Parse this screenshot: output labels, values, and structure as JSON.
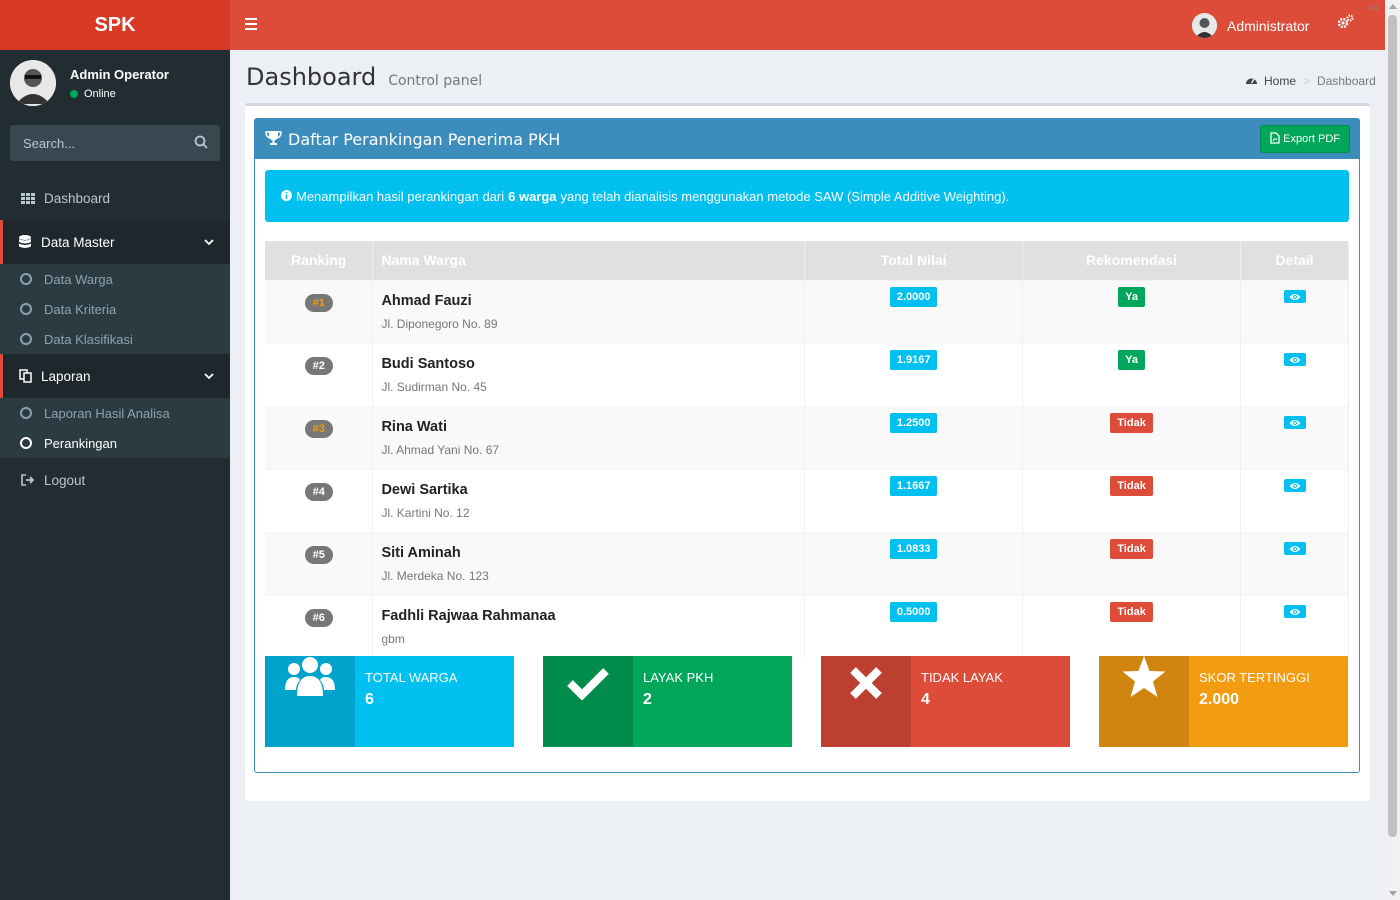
{
  "app": {
    "logo": "SPK"
  },
  "user": {
    "name": "Admin Operator",
    "status": "Online"
  },
  "search": {
    "placeholder": "Search..."
  },
  "sidebar": {
    "items": [
      {
        "label": "Dashboard",
        "icon": "grid-icon"
      },
      {
        "label": "Data Master",
        "icon": "database-icon",
        "children": [
          "Data Warga",
          "Data Kriteria",
          "Data Klasifikasi"
        ]
      },
      {
        "label": "Laporan",
        "icon": "copy-icon",
        "children": [
          "Laporan Hasil Analisa",
          "Perankingan"
        ]
      },
      {
        "label": "Logout",
        "icon": "sign-out-icon"
      }
    ]
  },
  "navbar": {
    "username": "Administrator"
  },
  "header": {
    "title": "Dashboard",
    "subtitle": "Control panel"
  },
  "breadcrumb": {
    "home": "Home",
    "current": "Dashboard"
  },
  "box": {
    "title": "Daftar Perankingan Penerima PKH",
    "export_label": "Export PDF"
  },
  "callout": {
    "prefix": "Menampilkan hasil perankingan dari",
    "bold": "6 warga",
    "suffix": "yang telah dianalisis menggunakan metode SAW (Simple Additive Weighting)."
  },
  "table": {
    "headers": [
      "Ranking",
      "Nama Warga",
      "Total Nilai",
      "Rekomendasi",
      "Detail"
    ],
    "rows": [
      {
        "rank": "#1",
        "name": "Ahmad Fauzi",
        "address": "Jl. Diponegoro No. 89",
        "score": "2.0000",
        "rec": "Ya"
      },
      {
        "rank": "#2",
        "name": "Budi Santoso",
        "address": "Jl. Sudirman No. 45",
        "score": "1.9167",
        "rec": "Ya"
      },
      {
        "rank": "#3",
        "name": "Rina Wati",
        "address": "Jl. Ahmad Yani No. 67",
        "score": "1.2500",
        "rec": "Tidak"
      },
      {
        "rank": "#4",
        "name": "Dewi Sartika",
        "address": "Jl. Kartini No. 12",
        "score": "1.1667",
        "rec": "Tidak"
      },
      {
        "rank": "#5",
        "name": "Siti Aminah",
        "address": "Jl. Merdeka No. 123",
        "score": "1.0833",
        "rec": "Tidak"
      },
      {
        "rank": "#6",
        "name": "Fadhli Rajwaa Rahmanaa",
        "address": "gbm",
        "score": "0.5000",
        "rec": "Tidak"
      }
    ]
  },
  "stats": [
    {
      "label": "TOTAL WARGA",
      "value": "6",
      "icon": "users-icon",
      "color": "#00c0ef",
      "dark": "#00a3cb"
    },
    {
      "label": "LAYAK PKH",
      "value": "2",
      "icon": "check-icon",
      "color": "#00a65a",
      "dark": "#008d4c"
    },
    {
      "label": "TIDAK LAYAK",
      "value": "4",
      "icon": "times-icon",
      "color": "#dd4b39",
      "dark": "#bc4030"
    },
    {
      "label": "SKOR TERTINGGI",
      "value": "2.000",
      "icon": "star-icon",
      "color": "#f39c12",
      "dark": "#cf850f"
    }
  ]
}
